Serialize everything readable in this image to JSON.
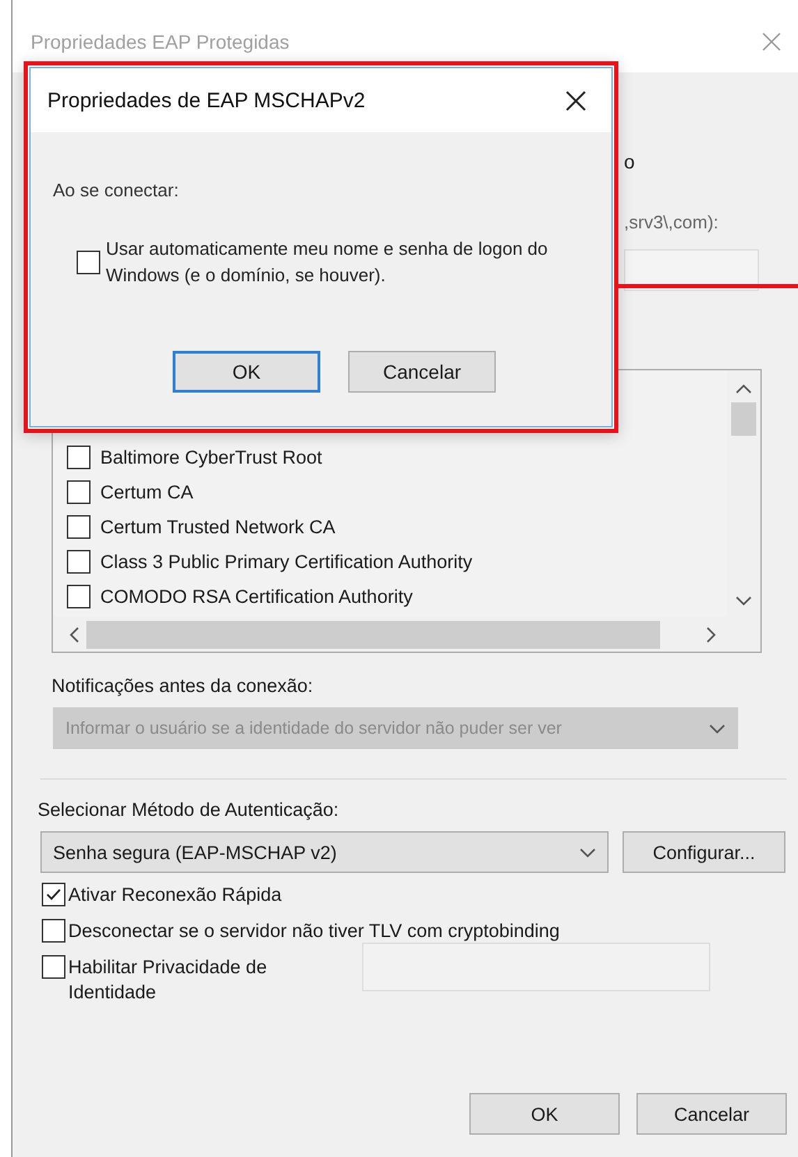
{
  "window": {
    "title": "Propriedades EAP Protegidas"
  },
  "hidden_fragments": {
    "group_heading": "o",
    "server_hint": ",srv3\\,com):"
  },
  "certificates": [
    {
      "label": "Baltimore CyberTrust Root",
      "checked": false
    },
    {
      "label": "Certum CA",
      "checked": false
    },
    {
      "label": "Certum Trusted Network CA",
      "checked": false
    },
    {
      "label": "Class 3 Public Primary Certification Authority",
      "checked": false
    },
    {
      "label": "COMODO RSA Certification Authority",
      "checked": false
    }
  ],
  "notifications": {
    "label": "Notificações antes da conexão:",
    "value": "Informar o usuário se a identidade do servidor não puder ser ver",
    "disabled": true
  },
  "auth_method": {
    "label": "Selecionar Método de Autenticação:",
    "value": "Senha segura (EAP-MSCHAP v2)",
    "configure_button": "Configurar..."
  },
  "options": [
    {
      "label": "Ativar Reconexão Rápida",
      "checked": true,
      "kind": "check"
    },
    {
      "label": "Desconectar se o servidor não tiver TLV com cryptobinding",
      "checked": false,
      "kind": "check"
    },
    {
      "label": "Habilitar Privacidade de Identidade",
      "checked": false,
      "kind": "check-field"
    }
  ],
  "buttons": [
    {
      "label": "OK"
    },
    {
      "label": "Cancelar"
    }
  ],
  "dialog": {
    "title": "Propriedades de EAP MSCHAPv2",
    "prompt": "Ao se conectar:",
    "option": {
      "label": "Usar automaticamente meu nome e senha de logon do Windows (e o domínio, se houver).",
      "checked": false
    },
    "buttons": [
      {
        "label": "OK",
        "default": true
      },
      {
        "label": "Cancelar",
        "default": false
      }
    ]
  }
}
